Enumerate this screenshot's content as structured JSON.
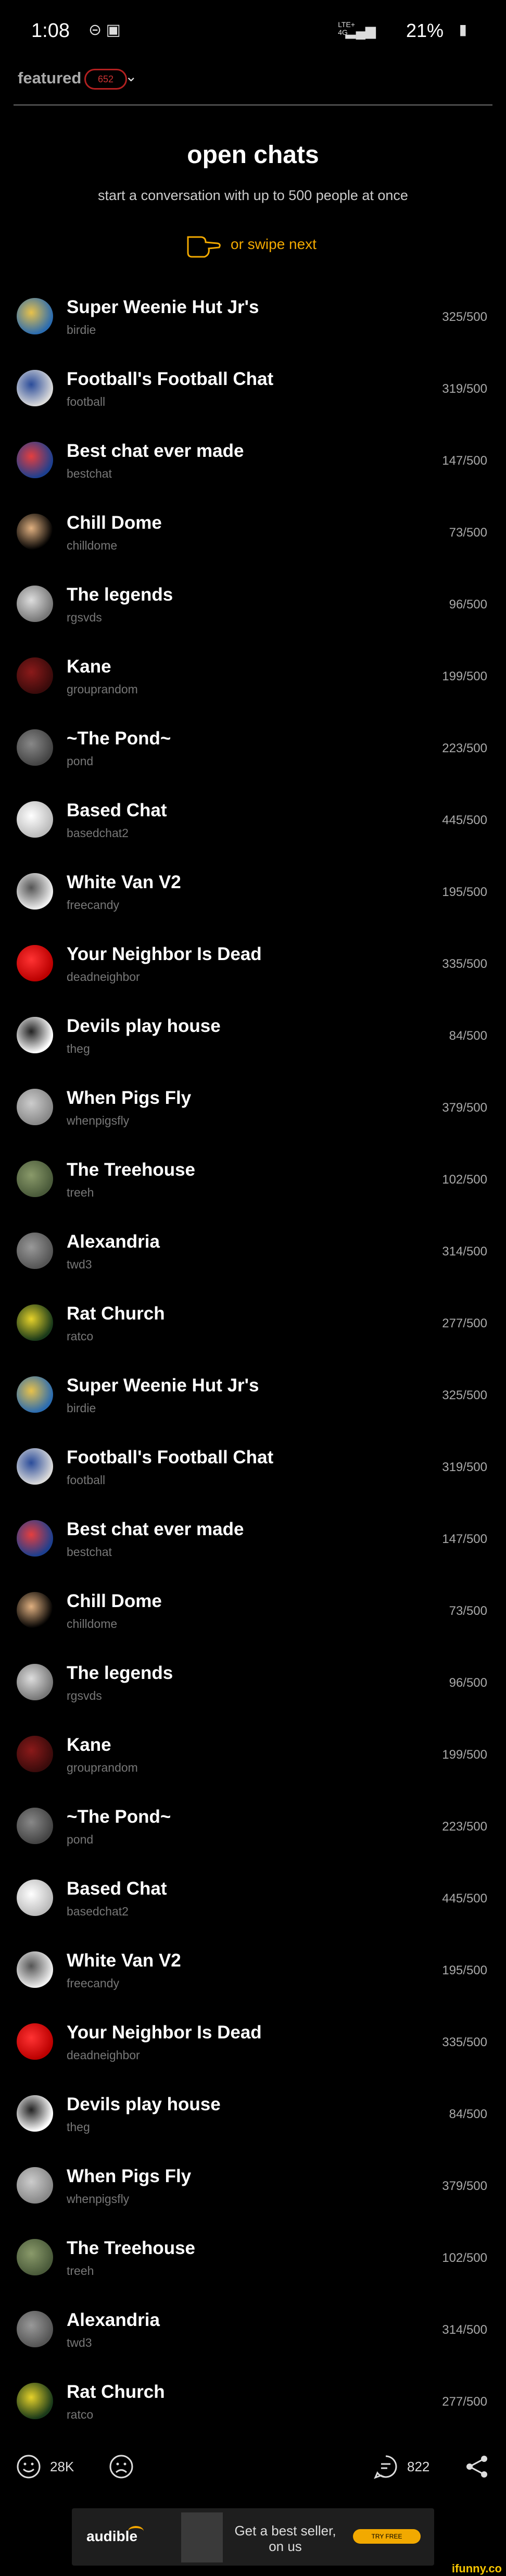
{
  "status_bar": {
    "time": "1:08",
    "left_icons": "⊝ ▣",
    "lte": "LTE+\n4G",
    "battery": "21%"
  },
  "header": {
    "featured_label": "featured",
    "badge_count": "652"
  },
  "hero": {
    "title": "open chats",
    "subtitle": "start a conversation with up to 500 people at once",
    "swipe_hint": "or swipe next"
  },
  "chats": [
    {
      "name": "Super Weenie Hut Jr's",
      "slug": "birdie",
      "count": "325/500"
    },
    {
      "name": "Football's Football Chat",
      "slug": "football",
      "count": "319/500"
    },
    {
      "name": "Best chat ever made",
      "slug": "bestchat",
      "count": "147/500"
    },
    {
      "name": "Chill Dome",
      "slug": "chilldome",
      "count": "73/500"
    },
    {
      "name": "The legends",
      "slug": "rgsvds",
      "count": "96/500"
    },
    {
      "name": "Kane",
      "slug": "grouprandom",
      "count": "199/500"
    },
    {
      "name": "~The Pond~",
      "slug": "pond",
      "count": "223/500"
    },
    {
      "name": "Based Chat",
      "slug": "basedchat2",
      "count": "445/500"
    },
    {
      "name": "White Van V2",
      "slug": "freecandy",
      "count": "195/500"
    },
    {
      "name": "Your Neighbor Is Dead",
      "slug": "deadneighbor",
      "count": "335/500"
    },
    {
      "name": "Devils play house",
      "slug": "theg",
      "count": "84/500"
    },
    {
      "name": "When Pigs Fly",
      "slug": "whenpigsfly",
      "count": "379/500"
    },
    {
      "name": "The Treehouse",
      "slug": "treeh",
      "count": "102/500"
    },
    {
      "name": "Alexandria",
      "slug": "twd3",
      "count": "314/500"
    },
    {
      "name": "Rat Church",
      "slug": "ratco",
      "count": "277/500"
    },
    {
      "name": "Super Weenie Hut Jr's",
      "slug": "birdie",
      "count": "325/500"
    },
    {
      "name": "Football's Football Chat",
      "slug": "football",
      "count": "319/500"
    },
    {
      "name": "Best chat ever made",
      "slug": "bestchat",
      "count": "147/500"
    },
    {
      "name": "Chill Dome",
      "slug": "chilldome",
      "count": "73/500"
    },
    {
      "name": "The legends",
      "slug": "rgsvds",
      "count": "96/500"
    },
    {
      "name": "Kane",
      "slug": "grouprandom",
      "count": "199/500"
    },
    {
      "name": "~The Pond~",
      "slug": "pond",
      "count": "223/500"
    },
    {
      "name": "Based Chat",
      "slug": "basedchat2",
      "count": "445/500"
    },
    {
      "name": "White Van V2",
      "slug": "freecandy",
      "count": "195/500"
    },
    {
      "name": "Your Neighbor Is Dead",
      "slug": "deadneighbor",
      "count": "335/500"
    },
    {
      "name": "Devils play house",
      "slug": "theg",
      "count": "84/500"
    },
    {
      "name": "When Pigs Fly",
      "slug": "whenpigsfly",
      "count": "379/500"
    },
    {
      "name": "The Treehouse",
      "slug": "treeh",
      "count": "102/500"
    },
    {
      "name": "Alexandria",
      "slug": "twd3",
      "count": "314/500"
    },
    {
      "name": "Rat Church",
      "slug": "ratco",
      "count": "277/500"
    }
  ],
  "bottom_bar": {
    "smile_count": "28K",
    "comment_count": "822"
  },
  "ad": {
    "brand": "audible",
    "text_line1": "Get a best seller,",
    "text_line2": "on us",
    "cta": "TRY FREE"
  },
  "watermark": "ifunny.co",
  "colors": {
    "accent": "#f2a900",
    "badge": "#b32020",
    "background": "#000000"
  }
}
